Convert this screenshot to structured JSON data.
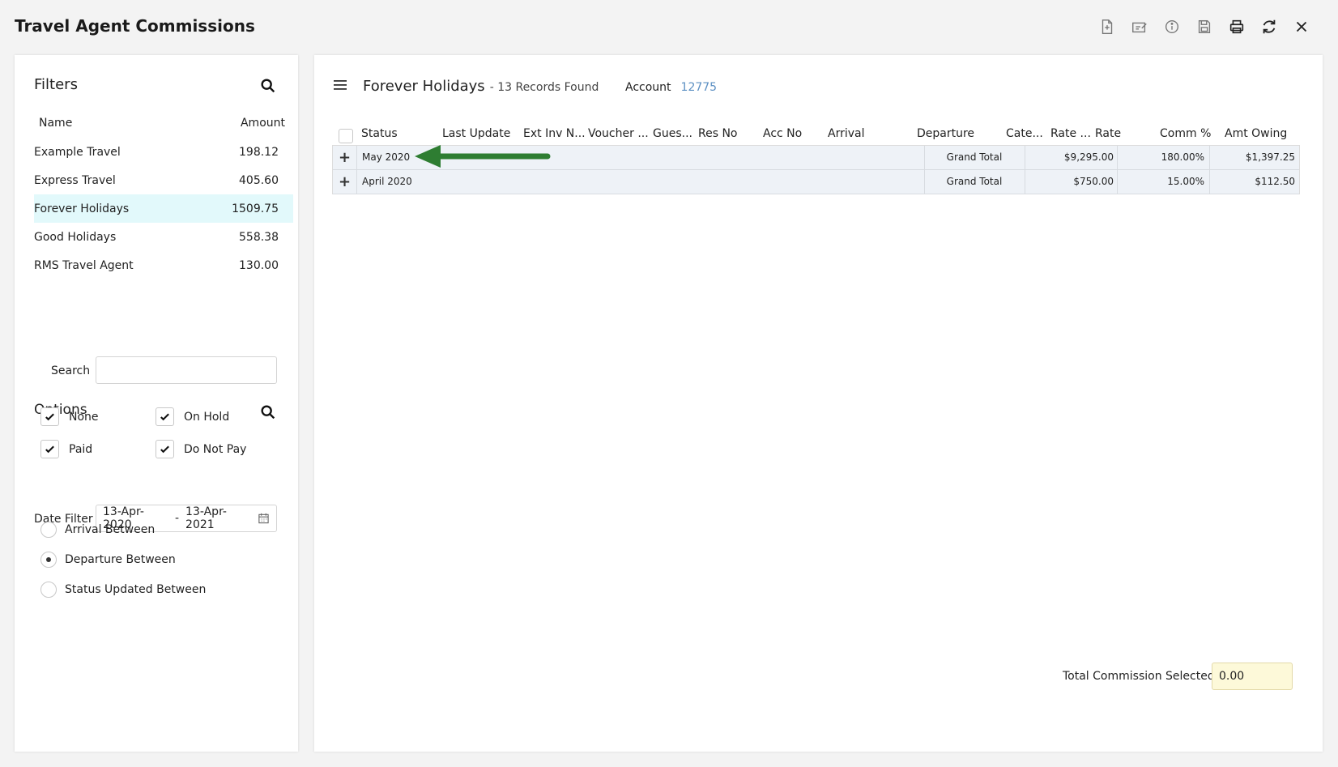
{
  "window": {
    "title": "Travel Agent Commissions"
  },
  "filters": {
    "heading": "Filters",
    "columns": {
      "name": "Name",
      "amount": "Amount"
    },
    "agents": [
      {
        "name": "Example Travel",
        "amount": "198.12"
      },
      {
        "name": "Express Travel",
        "amount": "405.60"
      },
      {
        "name": "Forever Holidays",
        "amount": "1509.75"
      },
      {
        "name": "Good Holidays",
        "amount": "558.38"
      },
      {
        "name": "RMS Travel Agent",
        "amount": "130.00"
      }
    ],
    "search_label": "Search",
    "search_value": ""
  },
  "options": {
    "heading": "Options",
    "checkboxes": [
      {
        "label": "None",
        "checked": true
      },
      {
        "label": "On Hold",
        "checked": true
      },
      {
        "label": "Paid",
        "checked": true
      },
      {
        "label": "Do Not Pay",
        "checked": true
      }
    ],
    "date_filter_label": "Date Filter",
    "date_from": "13-Apr-2020",
    "date_sep": "-",
    "date_to": "13-Apr-2021",
    "radios": [
      {
        "label": "Arrival Between",
        "selected": false
      },
      {
        "label": "Departure Between",
        "selected": true
      },
      {
        "label": "Status Updated Between",
        "selected": false
      }
    ]
  },
  "grid": {
    "title": "Forever Holidays",
    "count_text": "- 13 Records Found",
    "account_label": "Account",
    "account_number": "12775",
    "columns": [
      "Status",
      "Last Update",
      "Ext Inv N...",
      "Voucher ...",
      "Gues...",
      "Res No",
      "Acc No",
      "Arrival",
      "Departure",
      "Cate...",
      "Rate ...",
      "Rate",
      "Comm %",
      "Amt Owing"
    ],
    "rows": [
      {
        "group": "May 2020",
        "label": "Grand Total",
        "rate": "$9,295.00",
        "comm": "180.00%",
        "owing": "$1,397.25"
      },
      {
        "group": "April 2020",
        "label": "Grand Total",
        "rate": "$750.00",
        "comm": "15.00%",
        "owing": "$112.50"
      }
    ],
    "total_label": "Total Commission Selected",
    "total_value": "0.00"
  },
  "colors": {
    "selected_row": "#e2f9fb",
    "arrow": "#2e7d32",
    "account_link": "#5b8fc2",
    "total_bg": "#fdf9d9"
  }
}
